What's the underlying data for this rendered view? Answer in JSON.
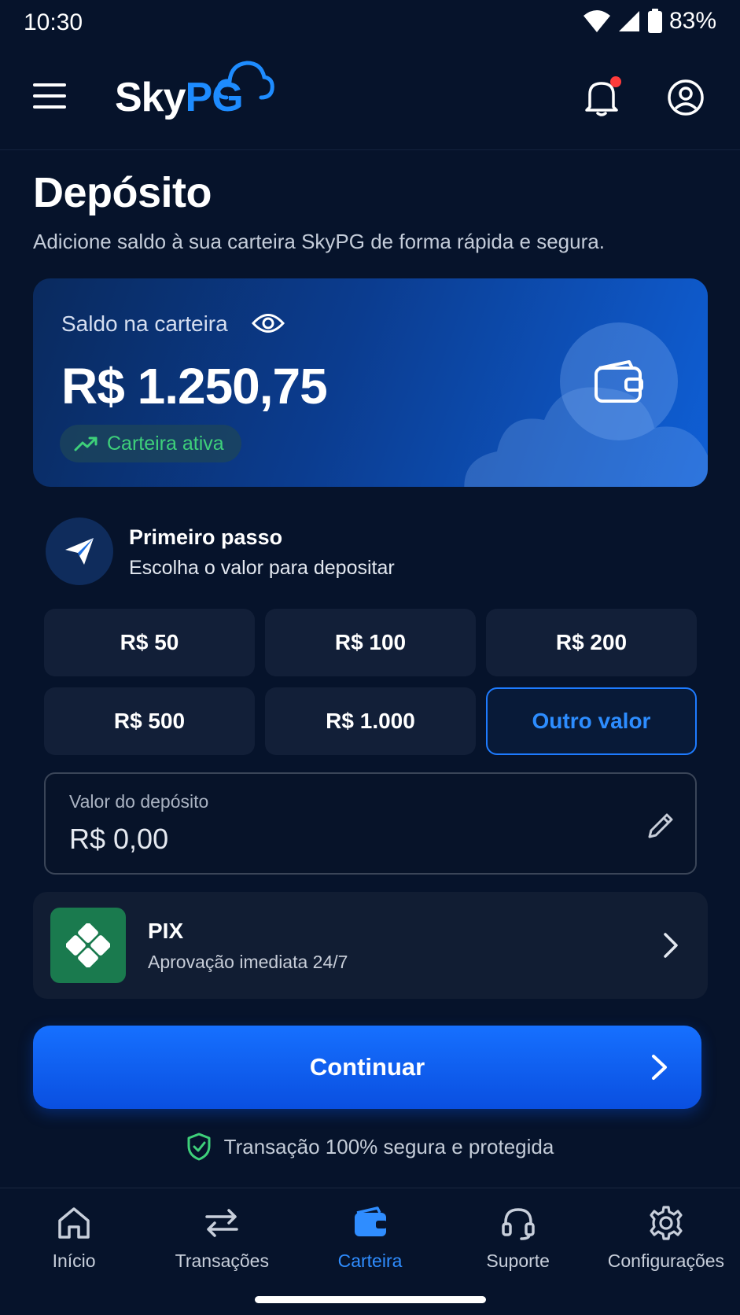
{
  "status_bar": {
    "time": "10:30",
    "battery": "83%"
  },
  "header": {
    "logo_sky": "Sky",
    "logo_pg": "PG",
    "notification_dot_color": "#ff3b3b"
  },
  "page": {
    "title": "Depósito",
    "subtitle": "Adicione saldo à sua carteira SkyPG de forma rápida e segura."
  },
  "balance_card": {
    "label": "Saldo na carteira",
    "amount": "R$ 1.250,75",
    "status": "Carteira ativa",
    "status_color": "#3ed07a"
  },
  "step": {
    "title": "Primeiro passo",
    "subtitle": "Escolha o valor para depositar"
  },
  "amounts": [
    {
      "label": "R$ 50",
      "selected": false
    },
    {
      "label": "R$ 100",
      "selected": false
    },
    {
      "label": "R$ 200",
      "selected": false
    },
    {
      "label": "R$ 500",
      "selected": false
    },
    {
      "label": "R$ 1.000",
      "selected": false
    },
    {
      "label": "Outro valor",
      "selected": true
    }
  ],
  "deposit": {
    "label": "Valor do depósito",
    "placeholder": "R$ 0,00"
  },
  "payment_method": {
    "title": "PIX",
    "subtitle": "Aprovação imediata 24/7",
    "color": "#1a7a4e"
  },
  "continue_button": {
    "label": "Continuar",
    "color": "#1670ff"
  },
  "secure_note": "Transação 100% segura e protegida",
  "bottom_nav": [
    {
      "label": "Início",
      "icon": "home-icon",
      "active": false
    },
    {
      "label": "Transações",
      "icon": "transfer-arrows-icon",
      "active": false
    },
    {
      "label": "Carteira",
      "icon": "wallet-icon",
      "active": true
    },
    {
      "label": "Suporte",
      "icon": "headset-icon",
      "active": false
    },
    {
      "label": "Configurações",
      "icon": "gear-icon",
      "active": false
    }
  ],
  "accent_color": "#1e7bff"
}
